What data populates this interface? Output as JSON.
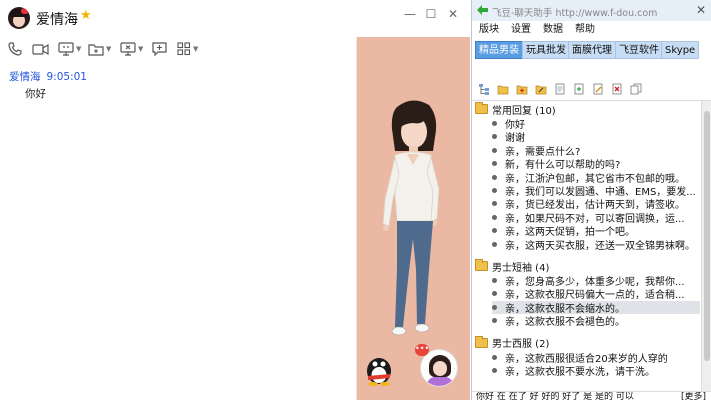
{
  "chat": {
    "contact_name": "爱情海",
    "star_icon": "star-icon",
    "window_buttons": {
      "minimize": "—",
      "maximize": "☐",
      "close": "✕"
    },
    "toolbar_icons": [
      "phone-icon",
      "video-icon",
      "screen-share-icon",
      "folder-icon",
      "remote-desktop-icon",
      "add-chat-icon",
      "apps-grid-icon"
    ],
    "messages": [
      {
        "sender": "爱情海",
        "time": "9:05:01",
        "text": "你好"
      }
    ]
  },
  "fdou": {
    "title": "飞豆-聊天助手 http://www.f-dou.com",
    "close": "✕",
    "menu": [
      "版块",
      "设置",
      "数据",
      "帮助"
    ],
    "tabs": [
      "精品男装",
      "玩具批发",
      "面膜代理",
      "飞豆软件",
      "Skype"
    ],
    "active_tab": "精品男装",
    "groups": [
      {
        "name": "常用回复 (10)",
        "items": [
          "你好",
          "谢谢",
          "亲，需要点什么?",
          "新，有什么可以帮助的吗?",
          "亲，江浙沪包邮，其它省市不包邮的哦。",
          "亲，我们可以发圆通、中通、EMS，要发...",
          "亲，货已经发出，估计两天到，请签收。",
          "亲，如果尺码不对，可以寄回调换，运...",
          "亲，这两天促销，拍一个吧。",
          "亲，这两天买衣服，还送一双全锦男袜啊。"
        ]
      },
      {
        "name": "男士短袖 (4)",
        "items": [
          "亲，您身高多少，体重多少呢，我帮你...",
          "亲，这款衣服尺码偏大一点的，适合稍...",
          "亲，这款衣服不会缩水的。",
          "亲，这款衣服不会褪色的。"
        ]
      },
      {
        "name": "男士西服 (2)",
        "items": [
          "亲，这款西服很适合20来岁的人穿的",
          "亲，这款衣服不要水洗，请干洗。"
        ]
      }
    ],
    "selected_item": "亲，这款衣服不会缩水的。",
    "bottom_text": "你好  在  在了  好  好的  好了  是  是的  可以",
    "bottom_right": "[更多]"
  }
}
